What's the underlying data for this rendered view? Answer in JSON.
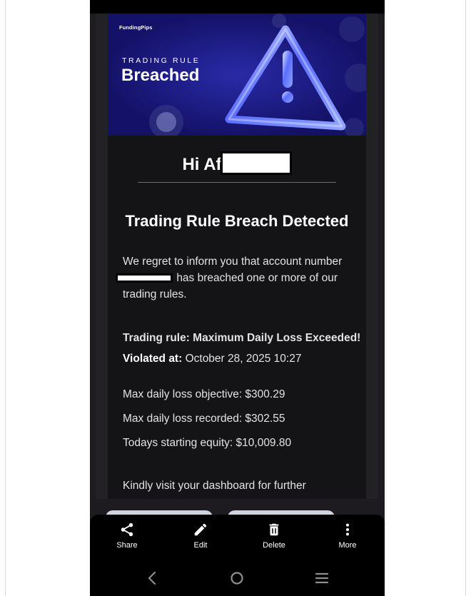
{
  "banner": {
    "logo": "FundingPips",
    "kicker": "TRADING RULE",
    "title": "Breached"
  },
  "email": {
    "greeting": "Hi Af",
    "heading": "Trading Rule Breach Detected",
    "intro_start": "We regret to inform you that account number",
    "intro_end": "has breached one or more of our trading rules.",
    "rule_label": "Trading rule: Maximum Daily Loss Exceeded!",
    "violated_label": "Violated at:",
    "violated_value": "October 28, 2025 10:27",
    "max_objective": "Max daily loss objective: $300.29",
    "max_recorded": "Max daily loss recorded: $302.55",
    "starting_equity": "Todays starting equity: $10,009.80",
    "closing": "Kindly visit your dashboard for further"
  },
  "actions": [
    {
      "label": "Share",
      "icon": "share-icon"
    },
    {
      "label": "Edit",
      "icon": "edit-icon"
    },
    {
      "label": "Delete",
      "icon": "delete-icon"
    },
    {
      "label": "More",
      "icon": "more-icon"
    }
  ],
  "colors": {
    "banner_bg": "#141268",
    "card_bg": "#141416",
    "action_bar": "#000000"
  }
}
